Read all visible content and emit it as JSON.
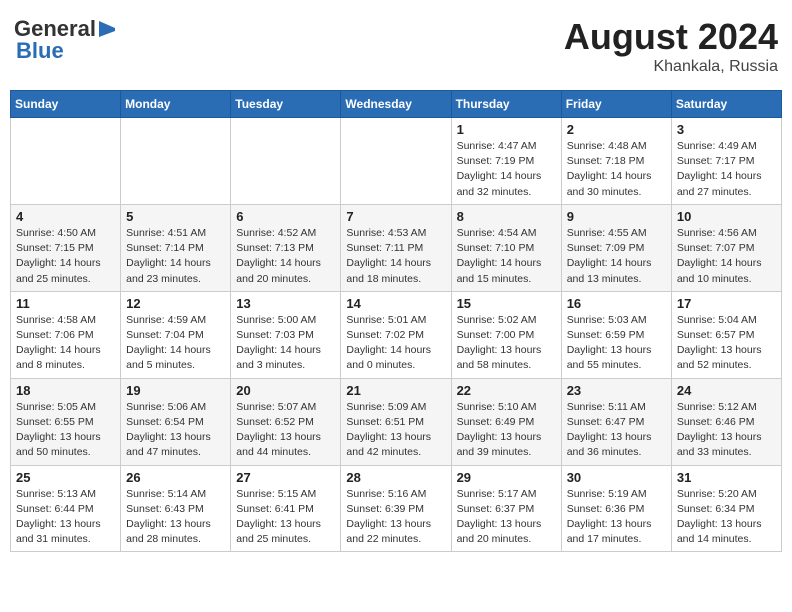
{
  "header": {
    "logo_line1": "General",
    "logo_line2": "Blue",
    "title": "August 2024",
    "subtitle": "Khankala, Russia"
  },
  "days_of_week": [
    "Sunday",
    "Monday",
    "Tuesday",
    "Wednesday",
    "Thursday",
    "Friday",
    "Saturday"
  ],
  "weeks": [
    [
      {
        "num": "",
        "detail": ""
      },
      {
        "num": "",
        "detail": ""
      },
      {
        "num": "",
        "detail": ""
      },
      {
        "num": "",
        "detail": ""
      },
      {
        "num": "1",
        "detail": "Sunrise: 4:47 AM\nSunset: 7:19 PM\nDaylight: 14 hours\nand 32 minutes."
      },
      {
        "num": "2",
        "detail": "Sunrise: 4:48 AM\nSunset: 7:18 PM\nDaylight: 14 hours\nand 30 minutes."
      },
      {
        "num": "3",
        "detail": "Sunrise: 4:49 AM\nSunset: 7:17 PM\nDaylight: 14 hours\nand 27 minutes."
      }
    ],
    [
      {
        "num": "4",
        "detail": "Sunrise: 4:50 AM\nSunset: 7:15 PM\nDaylight: 14 hours\nand 25 minutes."
      },
      {
        "num": "5",
        "detail": "Sunrise: 4:51 AM\nSunset: 7:14 PM\nDaylight: 14 hours\nand 23 minutes."
      },
      {
        "num": "6",
        "detail": "Sunrise: 4:52 AM\nSunset: 7:13 PM\nDaylight: 14 hours\nand 20 minutes."
      },
      {
        "num": "7",
        "detail": "Sunrise: 4:53 AM\nSunset: 7:11 PM\nDaylight: 14 hours\nand 18 minutes."
      },
      {
        "num": "8",
        "detail": "Sunrise: 4:54 AM\nSunset: 7:10 PM\nDaylight: 14 hours\nand 15 minutes."
      },
      {
        "num": "9",
        "detail": "Sunrise: 4:55 AM\nSunset: 7:09 PM\nDaylight: 14 hours\nand 13 minutes."
      },
      {
        "num": "10",
        "detail": "Sunrise: 4:56 AM\nSunset: 7:07 PM\nDaylight: 14 hours\nand 10 minutes."
      }
    ],
    [
      {
        "num": "11",
        "detail": "Sunrise: 4:58 AM\nSunset: 7:06 PM\nDaylight: 14 hours\nand 8 minutes."
      },
      {
        "num": "12",
        "detail": "Sunrise: 4:59 AM\nSunset: 7:04 PM\nDaylight: 14 hours\nand 5 minutes."
      },
      {
        "num": "13",
        "detail": "Sunrise: 5:00 AM\nSunset: 7:03 PM\nDaylight: 14 hours\nand 3 minutes."
      },
      {
        "num": "14",
        "detail": "Sunrise: 5:01 AM\nSunset: 7:02 PM\nDaylight: 14 hours\nand 0 minutes."
      },
      {
        "num": "15",
        "detail": "Sunrise: 5:02 AM\nSunset: 7:00 PM\nDaylight: 13 hours\nand 58 minutes."
      },
      {
        "num": "16",
        "detail": "Sunrise: 5:03 AM\nSunset: 6:59 PM\nDaylight: 13 hours\nand 55 minutes."
      },
      {
        "num": "17",
        "detail": "Sunrise: 5:04 AM\nSunset: 6:57 PM\nDaylight: 13 hours\nand 52 minutes."
      }
    ],
    [
      {
        "num": "18",
        "detail": "Sunrise: 5:05 AM\nSunset: 6:55 PM\nDaylight: 13 hours\nand 50 minutes."
      },
      {
        "num": "19",
        "detail": "Sunrise: 5:06 AM\nSunset: 6:54 PM\nDaylight: 13 hours\nand 47 minutes."
      },
      {
        "num": "20",
        "detail": "Sunrise: 5:07 AM\nSunset: 6:52 PM\nDaylight: 13 hours\nand 44 minutes."
      },
      {
        "num": "21",
        "detail": "Sunrise: 5:09 AM\nSunset: 6:51 PM\nDaylight: 13 hours\nand 42 minutes."
      },
      {
        "num": "22",
        "detail": "Sunrise: 5:10 AM\nSunset: 6:49 PM\nDaylight: 13 hours\nand 39 minutes."
      },
      {
        "num": "23",
        "detail": "Sunrise: 5:11 AM\nSunset: 6:47 PM\nDaylight: 13 hours\nand 36 minutes."
      },
      {
        "num": "24",
        "detail": "Sunrise: 5:12 AM\nSunset: 6:46 PM\nDaylight: 13 hours\nand 33 minutes."
      }
    ],
    [
      {
        "num": "25",
        "detail": "Sunrise: 5:13 AM\nSunset: 6:44 PM\nDaylight: 13 hours\nand 31 minutes."
      },
      {
        "num": "26",
        "detail": "Sunrise: 5:14 AM\nSunset: 6:43 PM\nDaylight: 13 hours\nand 28 minutes."
      },
      {
        "num": "27",
        "detail": "Sunrise: 5:15 AM\nSunset: 6:41 PM\nDaylight: 13 hours\nand 25 minutes."
      },
      {
        "num": "28",
        "detail": "Sunrise: 5:16 AM\nSunset: 6:39 PM\nDaylight: 13 hours\nand 22 minutes."
      },
      {
        "num": "29",
        "detail": "Sunrise: 5:17 AM\nSunset: 6:37 PM\nDaylight: 13 hours\nand 20 minutes."
      },
      {
        "num": "30",
        "detail": "Sunrise: 5:19 AM\nSunset: 6:36 PM\nDaylight: 13 hours\nand 17 minutes."
      },
      {
        "num": "31",
        "detail": "Sunrise: 5:20 AM\nSunset: 6:34 PM\nDaylight: 13 hours\nand 14 minutes."
      }
    ]
  ]
}
